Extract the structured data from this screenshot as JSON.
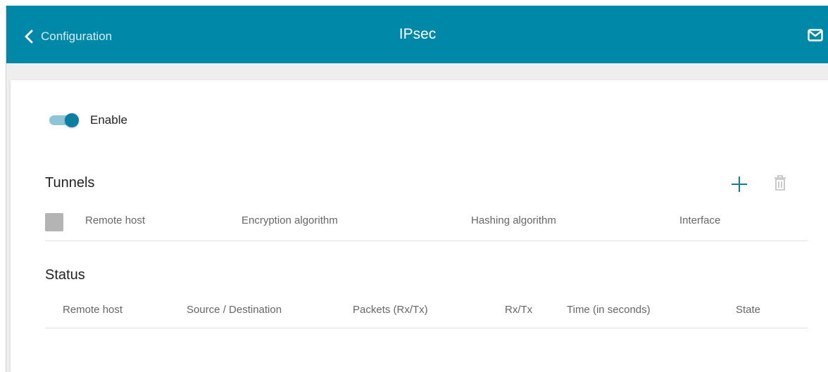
{
  "header": {
    "back_label": "Configuration",
    "title": "IPsec"
  },
  "enable": {
    "label": "Enable",
    "checked": true
  },
  "tunnels": {
    "title": "Tunnels",
    "columns": [
      "Remote host",
      "Encryption algorithm",
      "Hashing algorithm",
      "Interface"
    ]
  },
  "status": {
    "title": "Status",
    "columns": [
      "Remote host",
      "Source / Destination",
      "Packets (Rx/Tx)",
      "Rx/Tx",
      "Time (in seconds)",
      "State"
    ]
  },
  "icons": {
    "back": "chevron-left-icon",
    "mail": "mail-icon",
    "add": "plus-icon",
    "delete": "trash-icon"
  },
  "colors": {
    "header_bg": "#0088a9",
    "accent": "#0a7fa3",
    "toggle_track": "#8cc6d6"
  }
}
